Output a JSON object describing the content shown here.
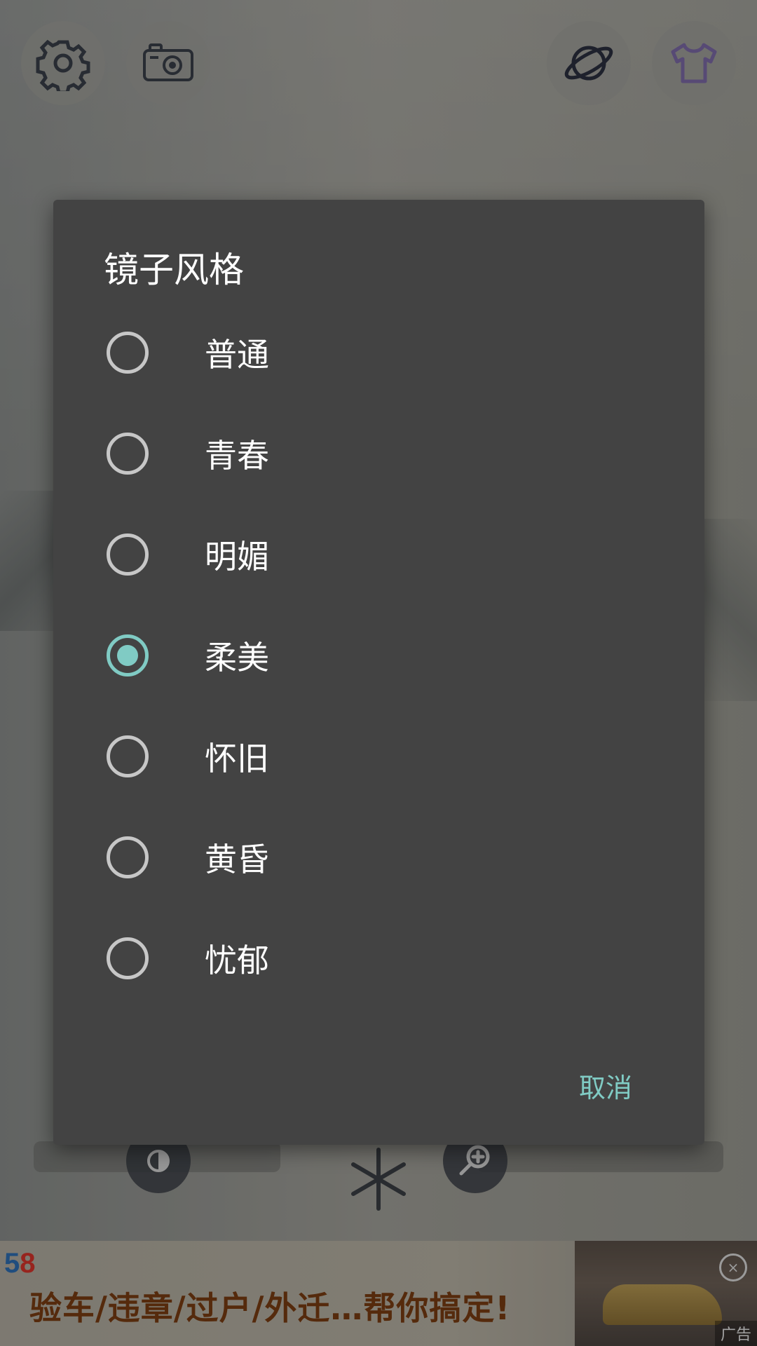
{
  "dialog": {
    "title": "镜子风格",
    "options": [
      {
        "label": "普通",
        "checked": false
      },
      {
        "label": "青春",
        "checked": false
      },
      {
        "label": "明媚",
        "checked": false
      },
      {
        "label": "柔美",
        "checked": true
      },
      {
        "label": "怀旧",
        "checked": false
      },
      {
        "label": "黄昏",
        "checked": false
      },
      {
        "label": "忧郁",
        "checked": false
      }
    ],
    "cancel_label": "取消"
  },
  "toolbar": {
    "icons": [
      "gear-icon",
      "camera-icon",
      "planet-icon",
      "tshirt-icon"
    ]
  },
  "bottom_controls": {
    "icons": [
      "brightness-icon",
      "snowflake-icon",
      "zoom-in-icon"
    ]
  },
  "ad": {
    "logo_5": "5",
    "logo_8": "8",
    "text": "验车/违章/过户/外迁…帮你搞定!",
    "close": "×",
    "tag": "广告"
  },
  "colors": {
    "accent": "#80cbc4",
    "dialog_bg": "#434343",
    "radio_unchecked": "#c7c7c7"
  }
}
